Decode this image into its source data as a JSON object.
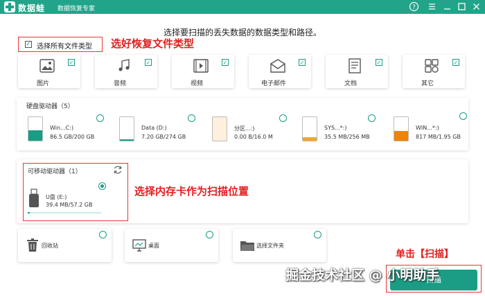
{
  "app": {
    "name": "数据蛙",
    "subtitle": "数据恢复专家"
  },
  "prompt": "选择要扫描的丢失数据的数据类型和路径。",
  "select_all": {
    "label": "选择所有文件类型",
    "checked": true
  },
  "annotations": {
    "select_types": "选好恢复文件类型",
    "select_card": "选择内存卡作为扫描位置",
    "click_scan": "单击【扫描】"
  },
  "file_types": [
    {
      "label": "图片",
      "icon": "image-icon",
      "checked": true
    },
    {
      "label": "音频",
      "icon": "music-icon",
      "checked": true
    },
    {
      "label": "视频",
      "icon": "video-icon",
      "checked": true
    },
    {
      "label": "电子邮件",
      "icon": "email-icon",
      "checked": true
    },
    {
      "label": "文档",
      "icon": "document-icon",
      "checked": true
    },
    {
      "label": "其它",
      "icon": "other-icon",
      "checked": true
    }
  ],
  "hard_drives": {
    "title": "硬盘驱动器（5）",
    "items": [
      {
        "name": "Win...C:)",
        "size": "86.5 GB/200 GB",
        "usage": 0.43,
        "color": "#1a9d84"
      },
      {
        "name": "Data (D:)",
        "size": "7.20 GB/274 GB",
        "usage": 0.03,
        "color": "#1a9d84"
      },
      {
        "name": "分区...:)",
        "size": "0.00  B/16.0 M",
        "usage": 0.0,
        "color": "#f5a623"
      },
      {
        "name": "SYS...*:)",
        "size": "35.5 MB/256 MB",
        "usage": 0.14,
        "color": "#f5a623"
      },
      {
        "name": "WIN...*:)",
        "size": "817 MB/1.95 GB",
        "usage": 0.42,
        "color": "#f08300"
      }
    ]
  },
  "removable": {
    "title": "可移动驱动器（1）",
    "item": {
      "name": "U盘 (E:)",
      "size": "39.4 MB/57.2 GB",
      "usage": 0.001,
      "selected": true
    }
  },
  "locations": [
    {
      "label": "回收站",
      "icon": "trash-icon"
    },
    {
      "label": "桌面",
      "icon": "desktop-icon"
    },
    {
      "label": "选择文件夹",
      "icon": "folder-icon"
    }
  ],
  "scan_label": "扫描",
  "watermark": "掘金技术社区 @ 小明助手",
  "colors": {
    "primary": "#1a9d84",
    "titlebar": "#22a48a",
    "annotation": "#e0201f"
  }
}
